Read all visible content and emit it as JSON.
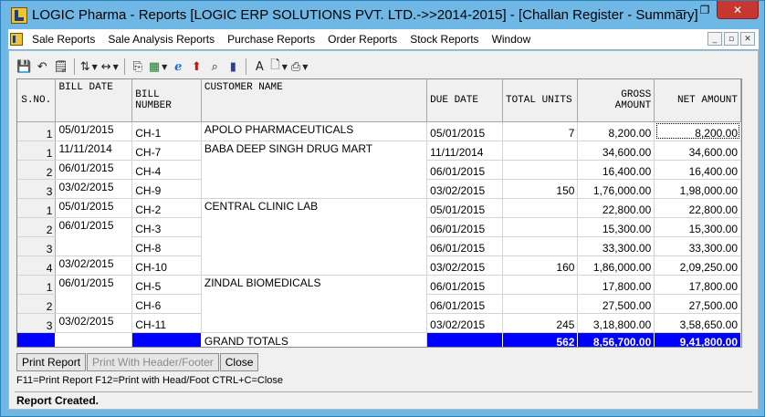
{
  "window": {
    "title": "LOGIC Pharma - Reports  [LOGIC ERP SOLUTIONS PVT. LTD.->>2014-2015] - [Challan Register - Summary]",
    "min_glyph": "—",
    "max_glyph": "❐",
    "close_glyph": "✕"
  },
  "menu": {
    "items": [
      "Sale Reports",
      "Sale Analysis Reports",
      "Purchase Reports",
      "Order Reports",
      "Stock Reports",
      "Window"
    ],
    "mdi_min": "_",
    "mdi_restore": "▫",
    "mdi_close": "✕"
  },
  "toolbar": {
    "icons": [
      "save-icon",
      "undo-icon",
      "notes-icon",
      "sort-icon",
      "column-width-icon",
      "copy-icon",
      "excel-icon",
      "browser-icon",
      "up-arrow-icon",
      "find-icon",
      "chart-icon",
      "font-icon",
      "preview-icon",
      "print-icon"
    ],
    "glyphs": {
      "save": "💾",
      "undo": "↶",
      "notes": "🗒",
      "sort": "⇅",
      "width": "↔",
      "copy": "⎘",
      "excel": "▦",
      "browser": "ℯ",
      "up": "⬆",
      "find": "⌕",
      "chart": "▮",
      "font": "A",
      "preview": "🗋",
      "print": "⎙"
    },
    "dropdown": "▼"
  },
  "table": {
    "headers": {
      "sno": "S.NO.",
      "bill_date": "BILL DATE",
      "bill_number": "BILL NUMBER",
      "customer": "CUSTOMER NAME",
      "due_date": "DUE DATE",
      "total_units": "TOTAL UNITS",
      "gross_amount": "GROSS AMOUNT",
      "net_amount": "NET AMOUNT"
    },
    "rows": [
      {
        "sno": "1",
        "bill_date": "05/01/2015",
        "bill_number": "CH-1",
        "customer": "APOLO PHARMACEUTICALS",
        "due_date": "05/01/2015",
        "total_units": "7",
        "gross_amount": "8,200.00",
        "net_amount": "8,200.00"
      },
      {
        "sno": "1",
        "bill_date": "11/11/2014",
        "bill_number": "CH-7",
        "customer": "BABA DEEP SINGH DRUG MART",
        "due_date": "11/11/2014",
        "total_units": "",
        "gross_amount": "34,600.00",
        "net_amount": "34,600.00"
      },
      {
        "sno": "2",
        "bill_date": "06/01/2015",
        "bill_number": "CH-4",
        "customer": "",
        "due_date": "06/01/2015",
        "total_units": "",
        "gross_amount": "16,400.00",
        "net_amount": "16,400.00"
      },
      {
        "sno": "3",
        "bill_date": "03/02/2015",
        "bill_number": "CH-9",
        "customer": "",
        "due_date": "03/02/2015",
        "total_units": "150",
        "gross_amount": "1,76,000.00",
        "net_amount": "1,98,000.00"
      },
      {
        "sno": "1",
        "bill_date": "05/01/2015",
        "bill_number": "CH-2",
        "customer": "CENTRAL CLINIC LAB",
        "due_date": "05/01/2015",
        "total_units": "",
        "gross_amount": "22,800.00",
        "net_amount": "22,800.00"
      },
      {
        "sno": "2",
        "bill_date": "06/01/2015",
        "bill_number": "CH-3",
        "customer": "",
        "due_date": "06/01/2015",
        "total_units": "",
        "gross_amount": "15,300.00",
        "net_amount": "15,300.00"
      },
      {
        "sno": "3",
        "bill_date": "",
        "bill_number": "CH-8",
        "customer": "",
        "due_date": "06/01/2015",
        "total_units": "",
        "gross_amount": "33,300.00",
        "net_amount": "33,300.00"
      },
      {
        "sno": "4",
        "bill_date": "03/02/2015",
        "bill_number": "CH-10",
        "customer": "",
        "due_date": "03/02/2015",
        "total_units": "160",
        "gross_amount": "1,86,000.00",
        "net_amount": "2,09,250.00"
      },
      {
        "sno": "1",
        "bill_date": "06/01/2015",
        "bill_number": "CH-5",
        "customer": "ZINDAL BIOMEDICALS",
        "due_date": "06/01/2015",
        "total_units": "",
        "gross_amount": "17,800.00",
        "net_amount": "17,800.00"
      },
      {
        "sno": "2",
        "bill_date": "",
        "bill_number": "CH-6",
        "customer": "",
        "due_date": "06/01/2015",
        "total_units": "",
        "gross_amount": "27,500.00",
        "net_amount": "27,500.00"
      },
      {
        "sno": "3",
        "bill_date": "03/02/2015",
        "bill_number": "CH-11",
        "customer": "",
        "due_date": "03/02/2015",
        "total_units": "245",
        "gross_amount": "3,18,800.00",
        "net_amount": "3,58,650.00"
      }
    ],
    "totals": {
      "label": "GRAND TOTALS",
      "total_units": "562",
      "gross_amount": "8,56,700.00",
      "net_amount": "9,41,800.00"
    },
    "total_bar_color": "#0000ff"
  },
  "buttons": {
    "print_report": "Print Report",
    "print_header_footer": "Print With Header/Footer",
    "close": "Close"
  },
  "hint": "F11=Print Report  F12=Print with Head/Foot  CTRL+C=Close",
  "status": "Report Created."
}
